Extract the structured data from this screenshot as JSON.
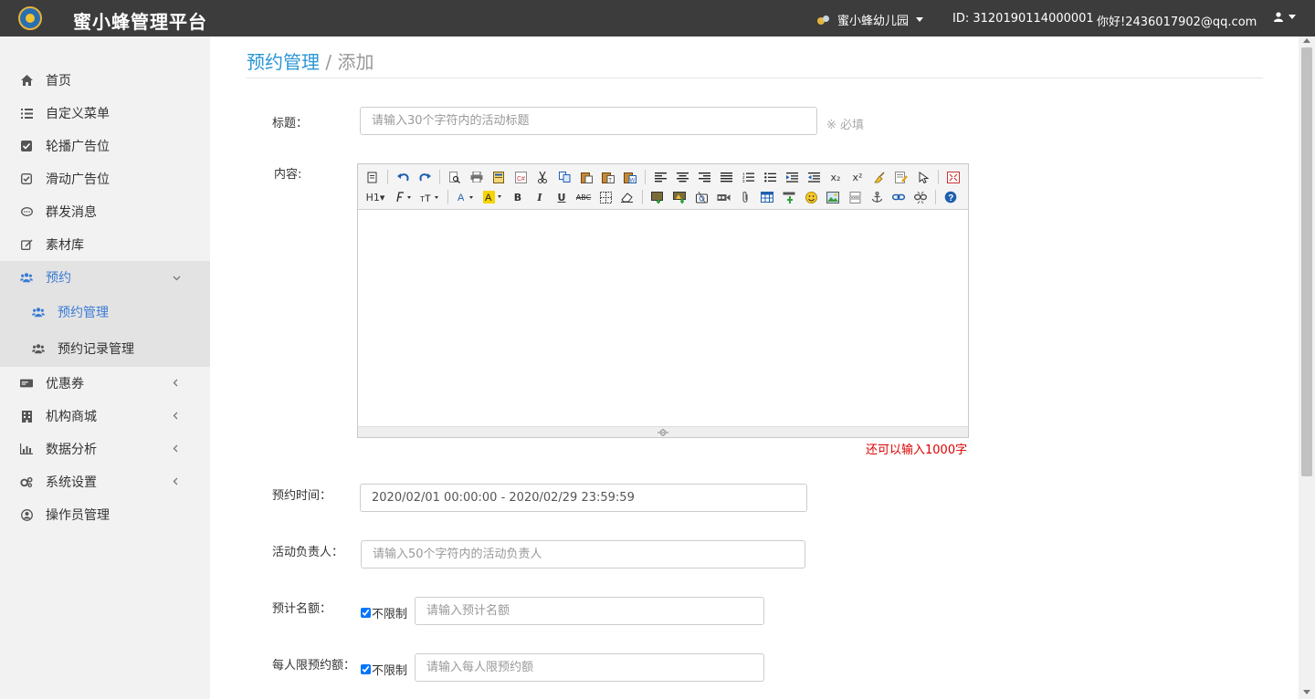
{
  "header": {
    "brand": "蜜小蜂管理平台",
    "org_name": "蜜小蜂幼儿园",
    "account_id": "ID:  3120190114000001",
    "greeting": "你好!2436017902@qq.com"
  },
  "sidebar": {
    "items": [
      {
        "label": "首页",
        "icon": "home-icon"
      },
      {
        "label": "自定义菜单",
        "icon": "list-icon"
      },
      {
        "label": "轮播广告位",
        "icon": "check-square-icon"
      },
      {
        "label": "滑动广告位",
        "icon": "check-square-outline-icon"
      },
      {
        "label": "群发消息",
        "icon": "comment-icon"
      },
      {
        "label": "素材库",
        "icon": "edit-icon"
      },
      {
        "label": "预约",
        "icon": "users-icon"
      },
      {
        "label": "预约管理",
        "icon": "users-icon"
      },
      {
        "label": "预约记录管理",
        "icon": "users-icon"
      },
      {
        "label": "优惠券",
        "icon": "coupon-icon"
      },
      {
        "label": "机构商城",
        "icon": "building-icon"
      },
      {
        "label": "数据分析",
        "icon": "bar-chart-icon"
      },
      {
        "label": "系统设置",
        "icon": "cogs-icon"
      },
      {
        "label": "操作员管理",
        "icon": "user-circle-icon"
      }
    ]
  },
  "breadcrumb": {
    "section": "预约管理",
    "separator": " / ",
    "page": "添加"
  },
  "form": {
    "title_label": "标题：",
    "title_placeholder": "请输入30个字符内的活动标题",
    "required_text": "※ 必填",
    "content_label": "内容:",
    "char_counter": "还可以输入1000字",
    "time_label": "预约时间：",
    "time_value": "2020/02/01 00:00:00 - 2020/02/29 23:59:59",
    "owner_label": "活动负责人：",
    "owner_placeholder": "请输入50个字符内的活动负责人",
    "quota_label": "预计名额：",
    "quota_unlimited": "不限制",
    "quota_placeholder": "请输入预计名额",
    "per_person_label": "每人限预约额：",
    "per_person_unlimited": "不限制",
    "per_person_placeholder": "请输入每人限预约额"
  },
  "editor": {
    "toolbar_texts": {
      "heading": "H1",
      "bold": "B",
      "italic": "I",
      "underline": "U",
      "strike": "ABC",
      "subscript": "x₂",
      "superscript": "x²",
      "help": "?"
    }
  }
}
